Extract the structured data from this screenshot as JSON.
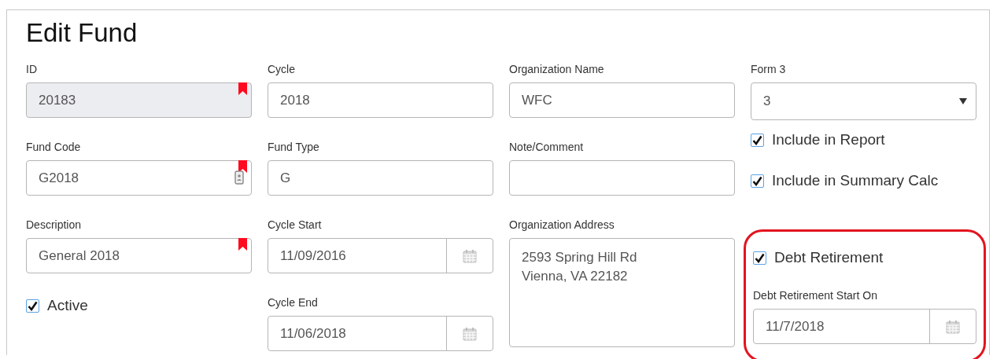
{
  "title": "Edit Fund",
  "columns": [
    {
      "items": [
        {
          "kind": "text",
          "label": "ID",
          "value": "20183",
          "disabled": true,
          "required": true,
          "lookup": false
        },
        {
          "kind": "text",
          "label": "Fund Code",
          "value": "G2018",
          "disabled": false,
          "required": true,
          "lookup": true
        },
        {
          "kind": "text",
          "label": "Description",
          "value": "General 2018",
          "disabled": false,
          "required": true,
          "lookup": false
        },
        {
          "kind": "checkbox",
          "label": "Active",
          "checked": true
        }
      ]
    },
    {
      "items": [
        {
          "kind": "text",
          "label": "Cycle",
          "value": "2018",
          "disabled": false,
          "required": false,
          "lookup": false
        },
        {
          "kind": "text",
          "label": "Fund Type",
          "value": "G",
          "disabled": false,
          "required": false,
          "lookup": false
        },
        {
          "kind": "date",
          "label": "Cycle Start",
          "value": "11/09/2016"
        },
        {
          "kind": "date",
          "label": "Cycle End",
          "value": "11/06/2018"
        }
      ]
    },
    {
      "items": [
        {
          "kind": "text",
          "label": "Organization Name",
          "value": "WFC",
          "disabled": false,
          "required": false,
          "lookup": false
        },
        {
          "kind": "text",
          "label": "Note/Comment",
          "value": "",
          "disabled": false,
          "required": false,
          "lookup": false
        },
        {
          "kind": "textarea",
          "label": "Organization Address",
          "lines": [
            "2593 Spring Hill Rd",
            "Vienna, VA 22182"
          ]
        }
      ]
    },
    {
      "items": [
        {
          "kind": "select",
          "label": "Form 3",
          "value": "3"
        },
        {
          "kind": "checkbox",
          "label": "Include in Report",
          "checked": true
        },
        {
          "kind": "checkbox",
          "label": "Include in Summary Calc",
          "checked": true
        },
        {
          "kind": "group",
          "highlighted": true,
          "items": [
            {
              "kind": "checkbox",
              "label": "Debt Retirement",
              "checked": true
            },
            {
              "kind": "date",
              "label": "Debt Retirement Start On",
              "value": "11/7/2018"
            }
          ]
        }
      ]
    }
  ]
}
